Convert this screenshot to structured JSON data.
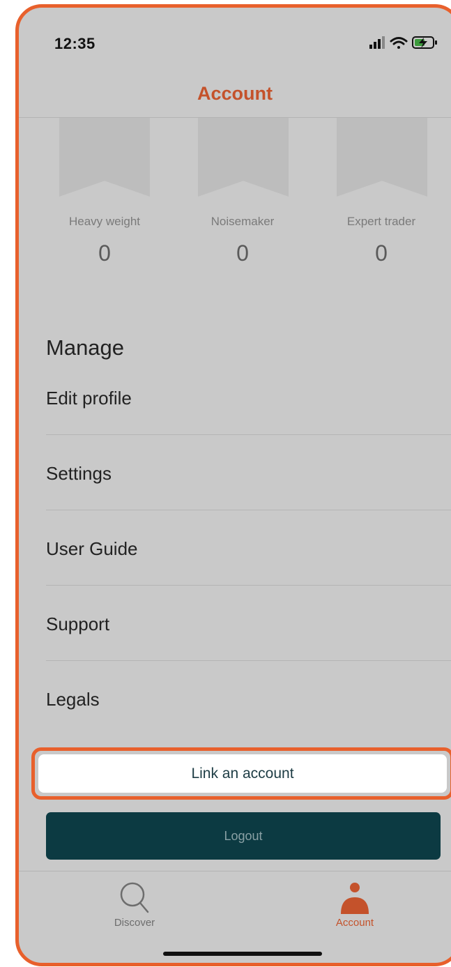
{
  "status_bar": {
    "time": "12:35",
    "icons": [
      "signal-icon",
      "wifi-icon",
      "battery-charging-icon"
    ]
  },
  "nav": {
    "title": "Account"
  },
  "badges": [
    {
      "label": "Heavy weight",
      "count": "0"
    },
    {
      "label": "Noisemaker",
      "count": "0"
    },
    {
      "label": "Expert trader",
      "count": "0"
    }
  ],
  "manage": {
    "heading": "Manage",
    "items": [
      {
        "label": "Edit profile"
      },
      {
        "label": "Settings"
      },
      {
        "label": "User Guide"
      },
      {
        "label": "Support"
      },
      {
        "label": "Legals"
      }
    ]
  },
  "actions": {
    "link_account": "Link an account",
    "logout": "Logout"
  },
  "tabbar": {
    "tabs": [
      {
        "label": "Discover",
        "icon": "search-icon",
        "active": false
      },
      {
        "label": "Account",
        "icon": "person-icon",
        "active": true
      }
    ]
  },
  "colors": {
    "accent": "#c4522b",
    "highlight_border": "#e8602c",
    "logout_bg": "#0c3a42",
    "screen_bg": "#c9c9c9"
  }
}
